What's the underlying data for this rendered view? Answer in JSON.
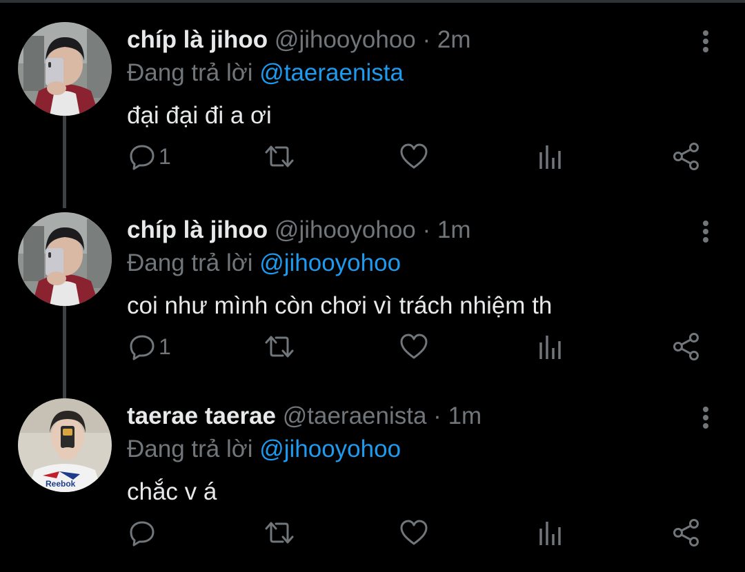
{
  "tweets": [
    {
      "name": "chíp là jihoo",
      "handle": "@jihooyohoo",
      "separator": "·",
      "time": "2m",
      "reply_prefix": "Đang trả lời",
      "reply_to": "@taeraenista",
      "text": "đại đại đi a ơi",
      "reply_count": "1",
      "avatar": "avatar-jihoo"
    },
    {
      "name": "chíp là jihoo",
      "handle": "@jihooyohoo",
      "separator": "·",
      "time": "1m",
      "reply_prefix": "Đang trả lời",
      "reply_to": "@jihooyohoo",
      "text": "coi như mình còn chơi vì trách nhiệm th",
      "reply_count": "1",
      "avatar": "avatar-jihoo"
    },
    {
      "name": "taerae taerae",
      "handle": "@taeraenista",
      "separator": "·",
      "time": "1m",
      "reply_prefix": "Đang trả lời",
      "reply_to": "@jihooyohoo",
      "text": "chắc v á",
      "reply_count": "",
      "avatar": "avatar-taerae"
    }
  ],
  "icons": {
    "reply": "reply-icon",
    "retweet": "retweet-icon",
    "like": "heart-icon",
    "views": "views-icon",
    "share": "share-icon",
    "more": "more-options-icon"
  },
  "colors": {
    "background": "#000000",
    "primary_text": "#e7e9ea",
    "secondary_text": "#71767b",
    "accent": "#1d9bf0"
  }
}
